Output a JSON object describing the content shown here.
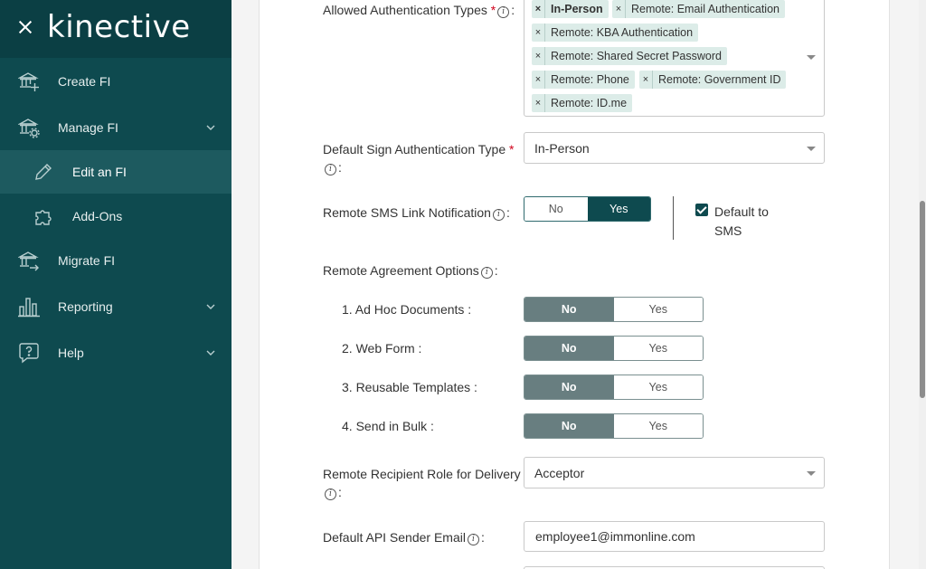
{
  "sidebar": {
    "logo": "kinective",
    "items": [
      {
        "label": "Create FI",
        "icon": "bank-plus-icon"
      },
      {
        "label": "Manage FI",
        "icon": "bank-gear-icon"
      },
      {
        "label": "Edit an FI",
        "icon": "pencil-icon"
      },
      {
        "label": "Add-Ons",
        "icon": "puzzle-icon"
      },
      {
        "label": "Migrate FI",
        "icon": "bank-arrow-icon"
      },
      {
        "label": "Reporting",
        "icon": "bar-chart-icon"
      },
      {
        "label": "Help",
        "icon": "help-bubble-icon"
      }
    ]
  },
  "form": {
    "allowed_auth": {
      "label": "Allowed Authentication Types",
      "tags": [
        "In-Person",
        "Remote: Email Authentication",
        "Remote: KBA Authentication",
        "Remote: Shared Secret Password",
        "Remote: Phone",
        "Remote: Government ID",
        "Remote: ID.me"
      ]
    },
    "default_sign_auth": {
      "label": "Default Sign Authentication Type",
      "value": "In-Person"
    },
    "remote_sms": {
      "label": "Remote SMS Link Notification",
      "no": "No",
      "yes": "Yes",
      "selected": "Yes",
      "default_to_sms_line1": "Default to",
      "default_to_sms_line2": "SMS",
      "default_to_sms_checked": true
    },
    "remote_agreement": {
      "label": "Remote Agreement Options",
      "options": [
        {
          "label": "1. Ad Hoc Documents :",
          "no": "No",
          "yes": "Yes",
          "selected": "No"
        },
        {
          "label": "2. Web Form :",
          "no": "No",
          "yes": "Yes",
          "selected": "No"
        },
        {
          "label": "3. Reusable Templates :",
          "no": "No",
          "yes": "Yes",
          "selected": "No"
        },
        {
          "label": "4. Send in Bulk :",
          "no": "No",
          "yes": "Yes",
          "selected": "No"
        }
      ]
    },
    "recipient_role": {
      "label": "Remote Recipient Role for Delivery",
      "value": "Acceptor"
    },
    "api_sender_email": {
      "label": "Default API Sender Email",
      "value": "employee1@immonline.com"
    }
  },
  "colors": {
    "sidebar_bg": "#0e4a4f",
    "accent": "#0e4a4f",
    "tag_bg": "#dcece8",
    "required": "#d0021b"
  }
}
